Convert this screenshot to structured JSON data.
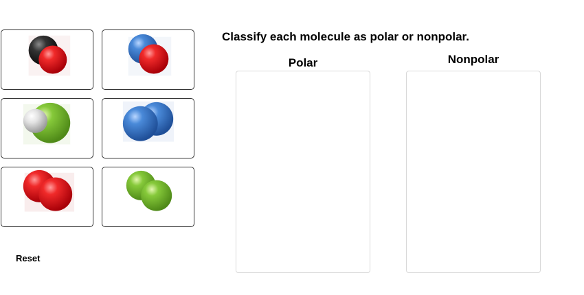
{
  "instruction": "Classify each molecule as polar or nonpolar.",
  "bins": {
    "polar_label": "Polar",
    "nonpolar_label": "Nonpolar"
  },
  "reset_label": "Reset",
  "molecules": [
    {
      "icon": "carbon-monoxide-molecule-icon",
      "atoms": [
        "black",
        "red"
      ],
      "colors": [
        "#2a2a2a",
        "#e0151b"
      ]
    },
    {
      "icon": "nitric-oxide-molecule-icon",
      "atoms": [
        "blue",
        "red"
      ],
      "colors": [
        "#3f7fd0",
        "#e0151b"
      ]
    },
    {
      "icon": "hydrogen-chloride-molecule-icon",
      "atoms": [
        "green",
        "white"
      ],
      "colors": [
        "#7ac143",
        "#d9d9d9"
      ]
    },
    {
      "icon": "nitrogen-molecule-icon",
      "atoms": [
        "blue",
        "blue"
      ],
      "colors": [
        "#3f7fd0",
        "#3f7fd0"
      ]
    },
    {
      "icon": "oxygen-molecule-icon",
      "atoms": [
        "red",
        "red"
      ],
      "colors": [
        "#e0151b",
        "#e0151b"
      ]
    },
    {
      "icon": "chlorine-molecule-icon",
      "atoms": [
        "green",
        "green"
      ],
      "colors": [
        "#7ac143",
        "#7ac143"
      ]
    }
  ]
}
